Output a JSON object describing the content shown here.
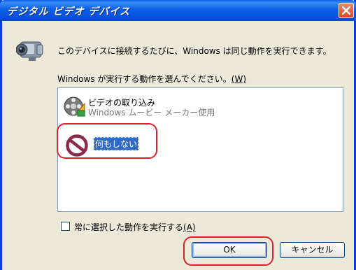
{
  "window": {
    "title": "デジタル ビデオ デバイス",
    "info_text": "このデバイスに接続するたびに、Windows は同じ動作を実行できます。"
  },
  "choose": {
    "label_text": "Windows が実行する動作を選んでください。",
    "label_accel": "(W)"
  },
  "list": {
    "items": [
      {
        "title": "ビデオの取り込み",
        "subtitle": "Windows ムービー メーカー使用",
        "icon": "film-reel-icon",
        "selected": false
      },
      {
        "title": "何もしない",
        "icon": "no-symbol-icon",
        "selected": true
      }
    ]
  },
  "checkbox": {
    "label_text": "常に選択した動作を実行する",
    "label_accel": "(A)",
    "checked": false
  },
  "buttons": {
    "ok": "OK",
    "cancel": "キャンセル"
  },
  "colors": {
    "titlebar": "#0b5ee6",
    "selection": "#316ac5",
    "highlight_annotation": "#e0202c",
    "close_button": "#d8461f"
  }
}
